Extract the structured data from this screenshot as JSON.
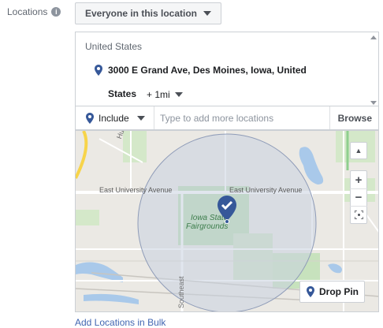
{
  "locations_label": "Locations",
  "audience_dropdown": {
    "label": "Everyone in this location"
  },
  "location_list": {
    "country": "United States",
    "address_line1": "3000 E Grand Ave, Des Moines, Iowa, United",
    "address_line2": "States",
    "radius": "+ 1mi"
  },
  "include_bar": {
    "include_label": "Include",
    "search_placeholder": "Type to add more locations",
    "browse_label": "Browse"
  },
  "map": {
    "street_labels": [
      "Hubbell",
      "East University Avenue",
      "East University Avenue",
      "Southeast"
    ],
    "poi_label_line1": "Iowa State",
    "poi_label_line2": "Fairgrounds",
    "zoom_in": "+",
    "zoom_out": "−",
    "drop_pin_label": "Drop Pin",
    "accent": "#4267b2",
    "radius_fill": "#c9d1e0",
    "park_color": "#c8e6c9",
    "water_color": "#a9c9ea"
  },
  "bulk_link": "Add Locations in Bulk"
}
